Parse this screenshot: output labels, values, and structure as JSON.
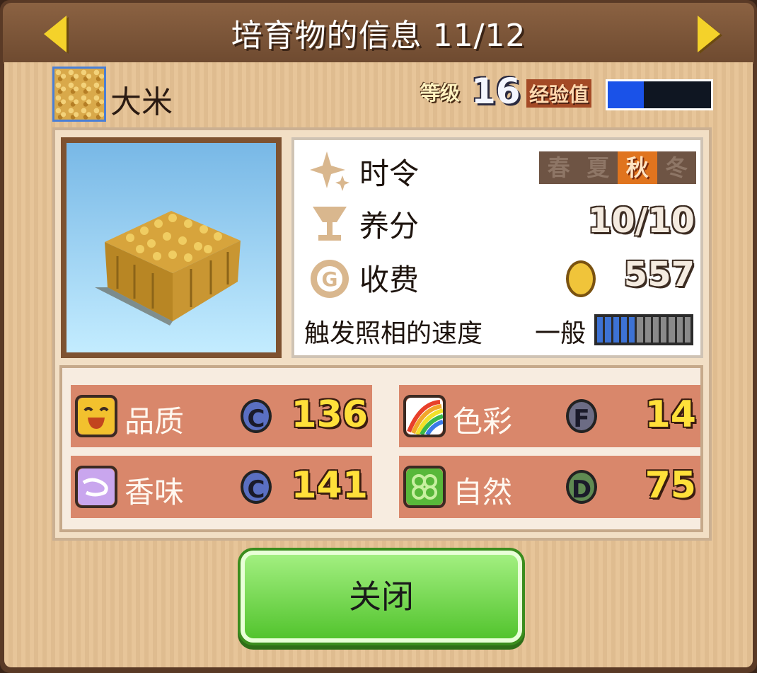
{
  "header": {
    "title": "培育物的信息 11/12",
    "prev_arrow": "left-arrow-icon",
    "next_arrow": "right-arrow-icon"
  },
  "crop": {
    "name": "大米",
    "icon": "rice-icon"
  },
  "level": {
    "label": "等级",
    "value": "16",
    "exp_label": "经验值",
    "exp_progress": 0.35
  },
  "info": {
    "season": {
      "label": "时令",
      "icon": "sparkle-icon",
      "seasons": [
        "春",
        "夏",
        "秋",
        "冬"
      ],
      "active_index": 2
    },
    "nutrients": {
      "label": "养分",
      "icon": "goblet-icon",
      "value": "10/10"
    },
    "fee": {
      "label": "收费",
      "icon": "g-coin-icon",
      "currency_icon": "gold-coin-icon",
      "value": "557"
    },
    "photo_speed": {
      "label": "触发照相的速度",
      "rating": "一般",
      "segments": 12,
      "filled": 5
    }
  },
  "stats": [
    {
      "name": "品质",
      "icon": "smiley-face-icon",
      "icon_color": "#f2c12e",
      "grade": "C",
      "grade_color": "#5a6fc2",
      "value": "136"
    },
    {
      "name": "色彩",
      "icon": "rainbow-icon",
      "icon_color": "#ffffff",
      "grade": "F",
      "grade_color": "#6c6c84",
      "value": "14"
    },
    {
      "name": "香味",
      "icon": "scent-cloud-icon",
      "icon_color": "#c9a6ee",
      "grade": "C",
      "grade_color": "#5a6fc2",
      "value": "141"
    },
    {
      "name": "自然",
      "icon": "clover-icon",
      "icon_color": "#58b83a",
      "grade": "D",
      "grade_color": "#5f8a52",
      "value": "75"
    }
  ],
  "footer": {
    "close_label": "关闭"
  }
}
